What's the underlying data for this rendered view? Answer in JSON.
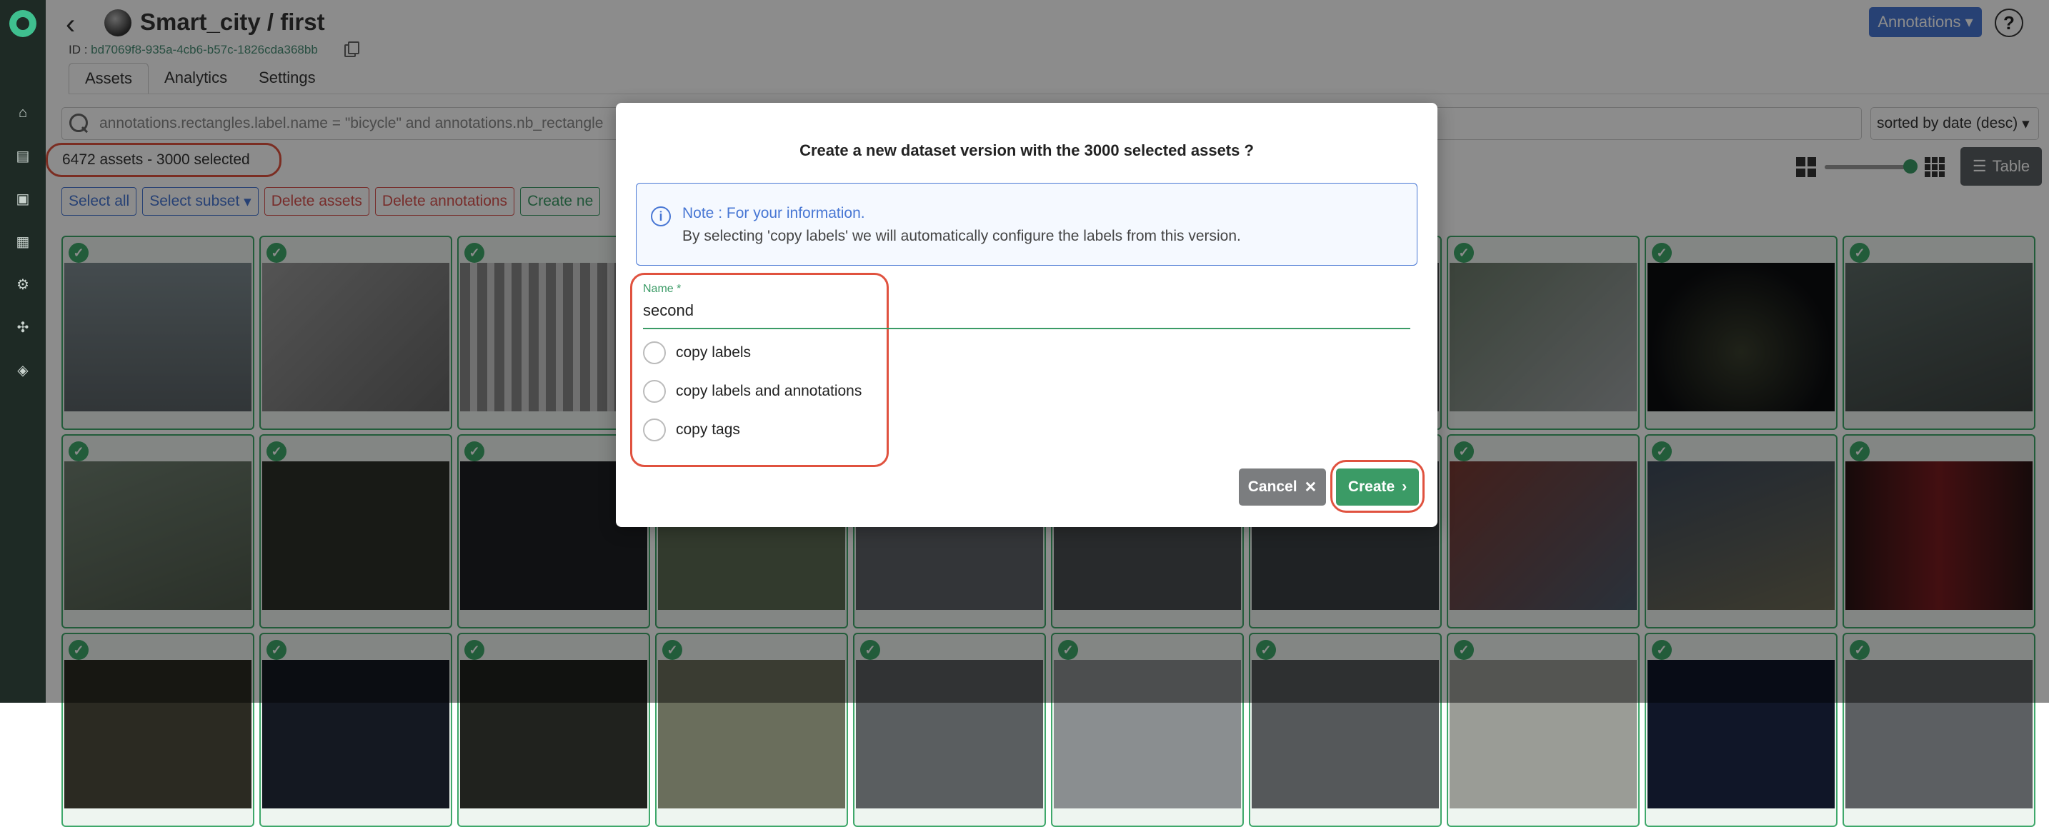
{
  "header": {
    "title": "Smart_city / first",
    "id_prefix": "ID : ",
    "id_value": "bd7069f8-935a-4cb6-b57c-1826cda368bb",
    "annotations_label": "Annotations",
    "help_label": "?"
  },
  "tabs": [
    "Assets",
    "Analytics",
    "Settings"
  ],
  "search": {
    "query": "annotations.rectangles.label.name = \"bicycle\" and annotations.nb_rectangle"
  },
  "sort": {
    "selected": "sorted by date (desc)"
  },
  "count_text": "6472 assets - 3000 selected",
  "view": {
    "table_label": "Table"
  },
  "actions": {
    "select_all": "Select all",
    "select_subset": "Select subset",
    "delete_assets": "Delete assets",
    "delete_annotations": "Delete annotations",
    "create_new": "Create ne"
  },
  "modal": {
    "title": "Create a new dataset version with the 3000 selected assets ?",
    "note_title": "Note : For your information.",
    "note_text": "By selecting 'copy labels' we will automatically configure the labels from this version.",
    "name_label": "Name *",
    "name_value": "second",
    "options": [
      "copy labels",
      "copy labels and annotations",
      "copy tags"
    ],
    "cancel_label": "Cancel",
    "create_label": "Create"
  },
  "colors": {
    "accent": "#4877d4",
    "success": "#3b9b66",
    "danger": "#e0523f"
  }
}
